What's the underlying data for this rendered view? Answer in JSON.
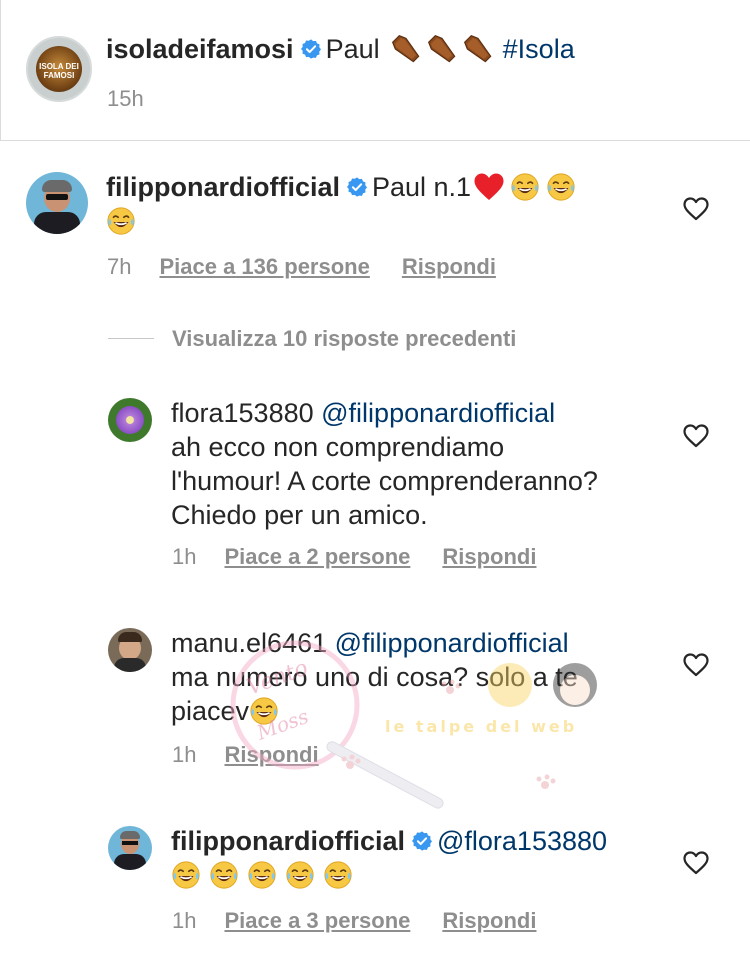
{
  "post": {
    "username": "isoladeifamosi",
    "caption_text": "Paul",
    "hashtag": "#Isola",
    "time": "15h",
    "avatar_text": "ISOLA DEI FAMOSI"
  },
  "comments": [
    {
      "username": "filipponardiofficial",
      "verified": true,
      "text": "Paul n.1",
      "time": "7h",
      "likes": "Piace a 136 persone",
      "reply": "Rispondi"
    }
  ],
  "view_previous": "Visualizza 10 risposte precedenti",
  "replies": [
    {
      "username": "flora153880",
      "mention": "@filipponardiofficial",
      "lines": [
        "ah ecco non comprendiamo",
        "l'humour! A corte comprenderanno?",
        "Chiedo per un amico."
      ],
      "time": "1h",
      "likes": "Piace a 2 persone",
      "reply": "Rispondi"
    },
    {
      "username": "manu.el6461",
      "mention": "@filipponardiofficial",
      "lines": [
        "ma numero uno di cosa? solo a te",
        "piacev"
      ],
      "time": "1h",
      "likes": "",
      "reply": "Rispondi"
    },
    {
      "username": "filipponardiofficial",
      "verified": true,
      "mention": "@flora153880",
      "time": "1h",
      "likes": "Piace a 3 persone",
      "reply": "Rispondi"
    }
  ],
  "colors": {
    "text": "#262626",
    "secondary": "#8e8e8e",
    "link": "#00376b",
    "verified": "#3897f0"
  },
  "icons": [
    "verified-badge-icon",
    "heart-outline-icon",
    "coffin-emoji",
    "laughing-tears-emoji",
    "red-heart-emoji"
  ]
}
